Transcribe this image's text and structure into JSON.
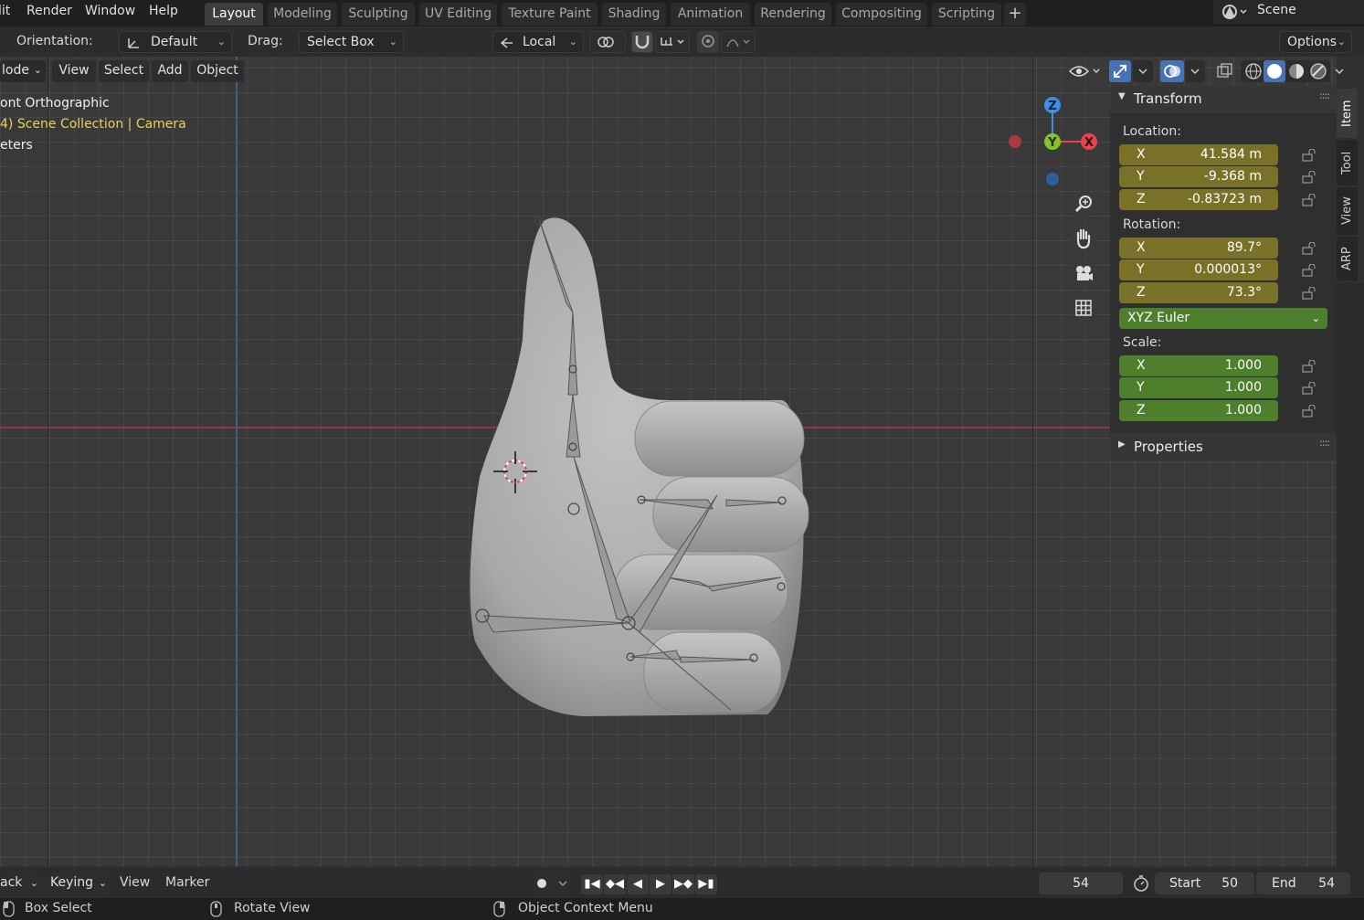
{
  "menu": {
    "items": [
      "lit",
      "Render",
      "Window",
      "Help"
    ]
  },
  "workspaces": [
    "Layout",
    "Modeling",
    "Sculpting",
    "UV Editing",
    "Texture Paint",
    "Shading",
    "Animation",
    "Rendering",
    "Compositing",
    "Scripting"
  ],
  "workspace_add": "+",
  "scene": {
    "name": "Scene"
  },
  "toolbar": {
    "orientation_label": "Orientation:",
    "orientation_value": "Default",
    "drag_label": "Drag:",
    "drag_value": "Select Box",
    "pivot_value": "Local",
    "options_label": "Options"
  },
  "viewport_header": {
    "mode": "lode",
    "view": "View",
    "select": "Select",
    "add": "Add",
    "object": "Object"
  },
  "overlay": {
    "view_name": "ont Orthographic",
    "collection": "4) Scene Collection | Camera",
    "units": "eters"
  },
  "gizmo": {
    "z": "Z",
    "y": "Y",
    "x": "X"
  },
  "transform_panel": {
    "title": "Transform",
    "location_label": "Location:",
    "location": [
      {
        "axis": "X",
        "value": "41.584 m"
      },
      {
        "axis": "Y",
        "value": "-9.368 m"
      },
      {
        "axis": "Z",
        "value": "-0.83723 m"
      }
    ],
    "rotation_label": "Rotation:",
    "rotation": [
      {
        "axis": "X",
        "value": "89.7°"
      },
      {
        "axis": "Y",
        "value": "0.000013°"
      },
      {
        "axis": "Z",
        "value": "73.3°"
      }
    ],
    "rotation_mode": "XYZ Euler",
    "scale_label": "Scale:",
    "scale": [
      {
        "axis": "X",
        "value": "1.000"
      },
      {
        "axis": "Y",
        "value": "1.000"
      },
      {
        "axis": "Z",
        "value": "1.000"
      }
    ]
  },
  "properties_panel": {
    "title": "Properties"
  },
  "side_tabs": [
    "Item",
    "Tool",
    "View",
    "ARP"
  ],
  "timeline": {
    "playback": "ack",
    "keying": "Keying",
    "view": "View",
    "marker": "Marker",
    "current_frame": "54",
    "start_label": "Start",
    "start": "50",
    "end_label": "End",
    "end": "54"
  },
  "status": {
    "left": "Box Select",
    "middle": "Rotate View",
    "right": "Object Context Menu"
  },
  "colors": {
    "accent": "#4772b3",
    "loc_rot_field": "#7a7128",
    "scale_field": "#4d7f2c",
    "x_axis": "#e8434f",
    "y_axis": "#86c128",
    "z_axis": "#3b8fe8"
  }
}
